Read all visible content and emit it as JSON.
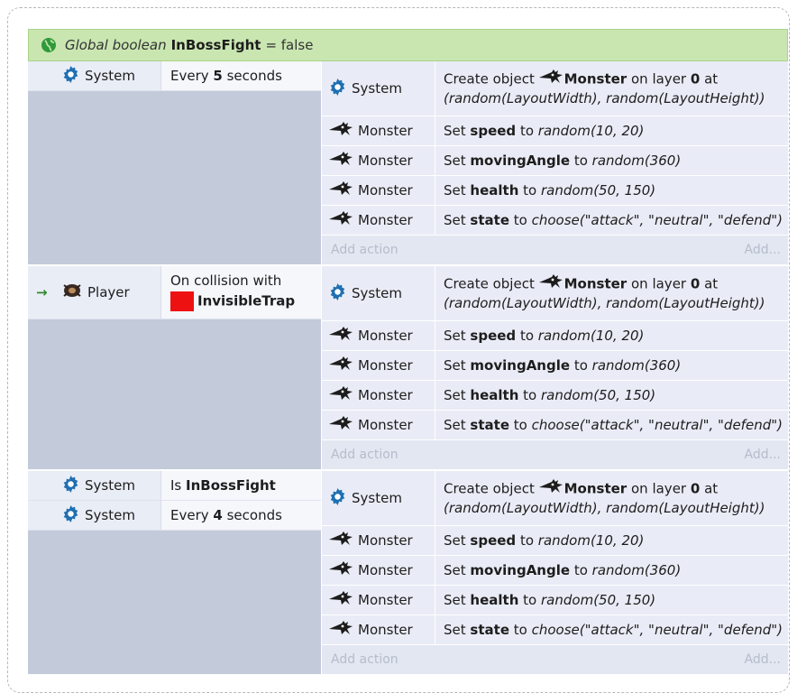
{
  "global_var": {
    "label": "Global boolean",
    "name": "InBossFight",
    "value_text": "= false"
  },
  "events": [
    {
      "trigger": false,
      "conditions": [
        {
          "object": "System",
          "icon": "gear-icon",
          "pre": "Every ",
          "bold": "5",
          "post": " seconds",
          "second_line": "",
          "has_square": false
        }
      ],
      "actions": [
        {
          "object": "System",
          "icon": "gear-icon",
          "type": "create"
        },
        {
          "object": "Monster",
          "icon": "monster-icon",
          "prop": "speed",
          "expr": "random(10, 20)"
        },
        {
          "object": "Monster",
          "icon": "monster-icon",
          "prop": "movingAngle",
          "expr": "random(360)"
        },
        {
          "object": "Monster",
          "icon": "monster-icon",
          "prop": "health",
          "expr": "random(50, 150)"
        },
        {
          "object": "Monster",
          "icon": "monster-icon",
          "prop": "state",
          "expr": "choose(\"attack\", \"neutral\", \"defend\")"
        }
      ]
    },
    {
      "trigger": true,
      "conditions": [
        {
          "object": "Player",
          "icon": "player-icon",
          "pre": "On collision with",
          "bold": "",
          "post": "",
          "second_line": "InvisibleTrap",
          "has_square": true
        }
      ],
      "actions": [
        {
          "object": "System",
          "icon": "gear-icon",
          "type": "create"
        },
        {
          "object": "Monster",
          "icon": "monster-icon",
          "prop": "speed",
          "expr": "random(10, 20)"
        },
        {
          "object": "Monster",
          "icon": "monster-icon",
          "prop": "movingAngle",
          "expr": "random(360)"
        },
        {
          "object": "Monster",
          "icon": "monster-icon",
          "prop": "health",
          "expr": "random(50, 150)"
        },
        {
          "object": "Monster",
          "icon": "monster-icon",
          "prop": "state",
          "expr": "choose(\"attack\", \"neutral\", \"defend\")"
        }
      ]
    },
    {
      "trigger": false,
      "conditions": [
        {
          "object": "System",
          "icon": "gear-icon",
          "pre": "Is ",
          "bold": "InBossFight",
          "post": "",
          "second_line": "",
          "has_square": false
        },
        {
          "object": "System",
          "icon": "gear-icon",
          "pre": "Every ",
          "bold": "4",
          "post": " seconds",
          "second_line": "",
          "has_square": false
        }
      ],
      "actions": [
        {
          "object": "System",
          "icon": "gear-icon",
          "type": "create"
        },
        {
          "object": "Monster",
          "icon": "monster-icon",
          "prop": "speed",
          "expr": "random(10, 20)"
        },
        {
          "object": "Monster",
          "icon": "monster-icon",
          "prop": "movingAngle",
          "expr": "random(360)"
        },
        {
          "object": "Monster",
          "icon": "monster-icon",
          "prop": "health",
          "expr": "random(50, 150)"
        },
        {
          "object": "Monster",
          "icon": "monster-icon",
          "prop": "state",
          "expr": "choose(\"attack\", \"neutral\", \"defend\")"
        }
      ]
    }
  ],
  "create_action": {
    "prefix": "Create object",
    "object": "Monster",
    "mid": "on layer",
    "layer": "0",
    "suffix": "at",
    "line2": "(random(LayoutWidth), random(LayoutHeight))"
  },
  "labels": {
    "set": "Set",
    "to": "to",
    "add_action": "Add action",
    "add_more": "Add..."
  },
  "colors": {
    "global_bg": "#c9e6b1",
    "condition_bg": "#c3cad9",
    "action_bg": "#e9ecf6",
    "gear": "#1f6fb2",
    "trap_square": "#ee1111",
    "trigger_arrow": "#2e8b2e"
  }
}
